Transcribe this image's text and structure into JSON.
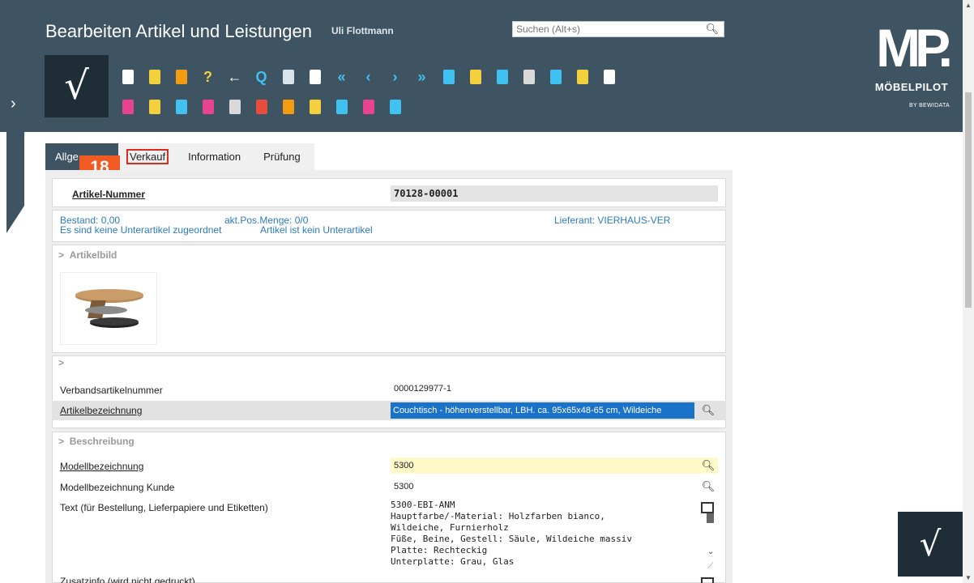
{
  "header": {
    "title": "Bearbeiten Artikel und Leistungen",
    "user": "Uli Flottmann",
    "search_placeholder": "Suchen (Alt+s)",
    "confirm_glyph": "√",
    "toolbar_row1": [
      {
        "name": "new-document-icon",
        "color": "#ffffff"
      },
      {
        "name": "folder-icon",
        "color": "#f4d03f"
      },
      {
        "name": "delete-bin-icon",
        "color": "#f39c12"
      },
      {
        "name": "help-icon",
        "glyph": "?",
        "color": "#f4d03f"
      },
      {
        "name": "back-icon",
        "glyph": "←",
        "color": "#ffffff"
      },
      {
        "name": "search-icon",
        "glyph": "Q",
        "color": "#3fc1f1"
      },
      {
        "name": "print-icon",
        "color": "#d9e3ea"
      },
      {
        "name": "layers-icon",
        "color": "#ffffff"
      },
      {
        "name": "first-icon",
        "glyph": "«",
        "color": "#3fc1f1"
      },
      {
        "name": "previous-icon",
        "glyph": "‹",
        "color": "#3fc1f1"
      },
      {
        "name": "next-icon",
        "glyph": "›",
        "color": "#3fc1f1"
      },
      {
        "name": "last-icon",
        "glyph": "»",
        "color": "#3fc1f1"
      },
      {
        "name": "box-icon",
        "color": "#3fc1f1"
      },
      {
        "name": "coins-icon",
        "color": "#f4d03f"
      },
      {
        "name": "package-icon",
        "color": "#3fc1f1"
      },
      {
        "name": "screw-icon",
        "color": "#d9d9d9"
      },
      {
        "name": "pie-chart-icon",
        "color": "#3fc1f1"
      },
      {
        "name": "money-icon",
        "color": "#f4d03f"
      },
      {
        "name": "copy-icon",
        "color": "#ffffff"
      }
    ],
    "toolbar_row2": [
      {
        "name": "calendar-01-icon",
        "color": "#e84393"
      },
      {
        "name": "chart-icon",
        "color": "#f4d03f"
      },
      {
        "name": "calendar-30-icon",
        "color": "#3fc1f1"
      },
      {
        "name": "tag-icon",
        "color": "#e84393"
      },
      {
        "name": "shield-icon",
        "color": "#d9d9d9"
      },
      {
        "name": "flag-de-en-icon",
        "color": "#e74c3c"
      },
      {
        "name": "sun-icon",
        "color": "#f39c12"
      },
      {
        "name": "factory-icon",
        "color": "#f4d03f"
      },
      {
        "name": "truck-icon",
        "color": "#3fc1f1"
      },
      {
        "name": "document-edit-icon",
        "color": "#e84393"
      },
      {
        "name": "text-field-icon",
        "color": "#3fc1f1"
      }
    ]
  },
  "brand": {
    "logo": "MP.",
    "name": "MÖBELPILOT",
    "by": "BY BEWIDATA"
  },
  "tabs": [
    {
      "label": "Allgemein",
      "visible_label": "Allge"
    },
    {
      "label": "Verkauf"
    },
    {
      "label": "Information"
    },
    {
      "label": "Prüfung"
    }
  ],
  "step_badge": "18",
  "form": {
    "artikel_nummer_label": "Artikel-Nummer",
    "artikel_nummer_value": "70128-00001",
    "bestand": "Bestand: 0,00",
    "akt_pos_menge": "akt.Pos.Menge: 0/0",
    "lieferant": "Lieferant: VIERHAUS-VER",
    "unterartikel": "Es sind keine Unterartikel zugeordnet",
    "kein_unterartikel": "Artikel ist kein Unterartikel",
    "section_artikelbild": "Artikelbild",
    "section_collapsed_glyph": ">",
    "verbandsartikelnummer_label": "Verbandsartikelnummer",
    "verbandsartikelnummer_value": "0000129977-1",
    "artikelbezeichnung_label": "Artikelbezeichnung",
    "artikelbezeichnung_value": "Couchtisch - höhenverstellbar, LBH. ca. 95x65x48-65 cm, Wildeiche",
    "section_beschreibung": "Beschreibung",
    "modellbezeichnung_label": "Modellbezeichnung",
    "modellbezeichnung_value": "5300",
    "modellbezeichnung_kunde_label": "Modellbezeichnung Kunde",
    "modellbezeichnung_kunde_value": "5300",
    "text_label": "Text (für Bestellung, Lieferpapiere und Etiketten)",
    "text_value": "5300-EBI-ANM\nHauptfarbe/-Material: Holzfarben bianco,\nWildeiche, Furnierholz\nFüße, Beine, Gestell: Säule, Wildeiche massiv\nPlatte: Rechteckig\nUnterplatte: Grau, Glas",
    "zusatzinfo_label": "Zusatzinfo (wird nicht gedruckt)"
  },
  "colors": {
    "header_bg": "#3e5463",
    "dark_button": "#1e2d36",
    "badge": "#f15a22",
    "highlight_border": "#d62d20",
    "info_text": "#2e7bbf",
    "selection": "#1a73c8",
    "yellow_field": "#fff9c9"
  }
}
